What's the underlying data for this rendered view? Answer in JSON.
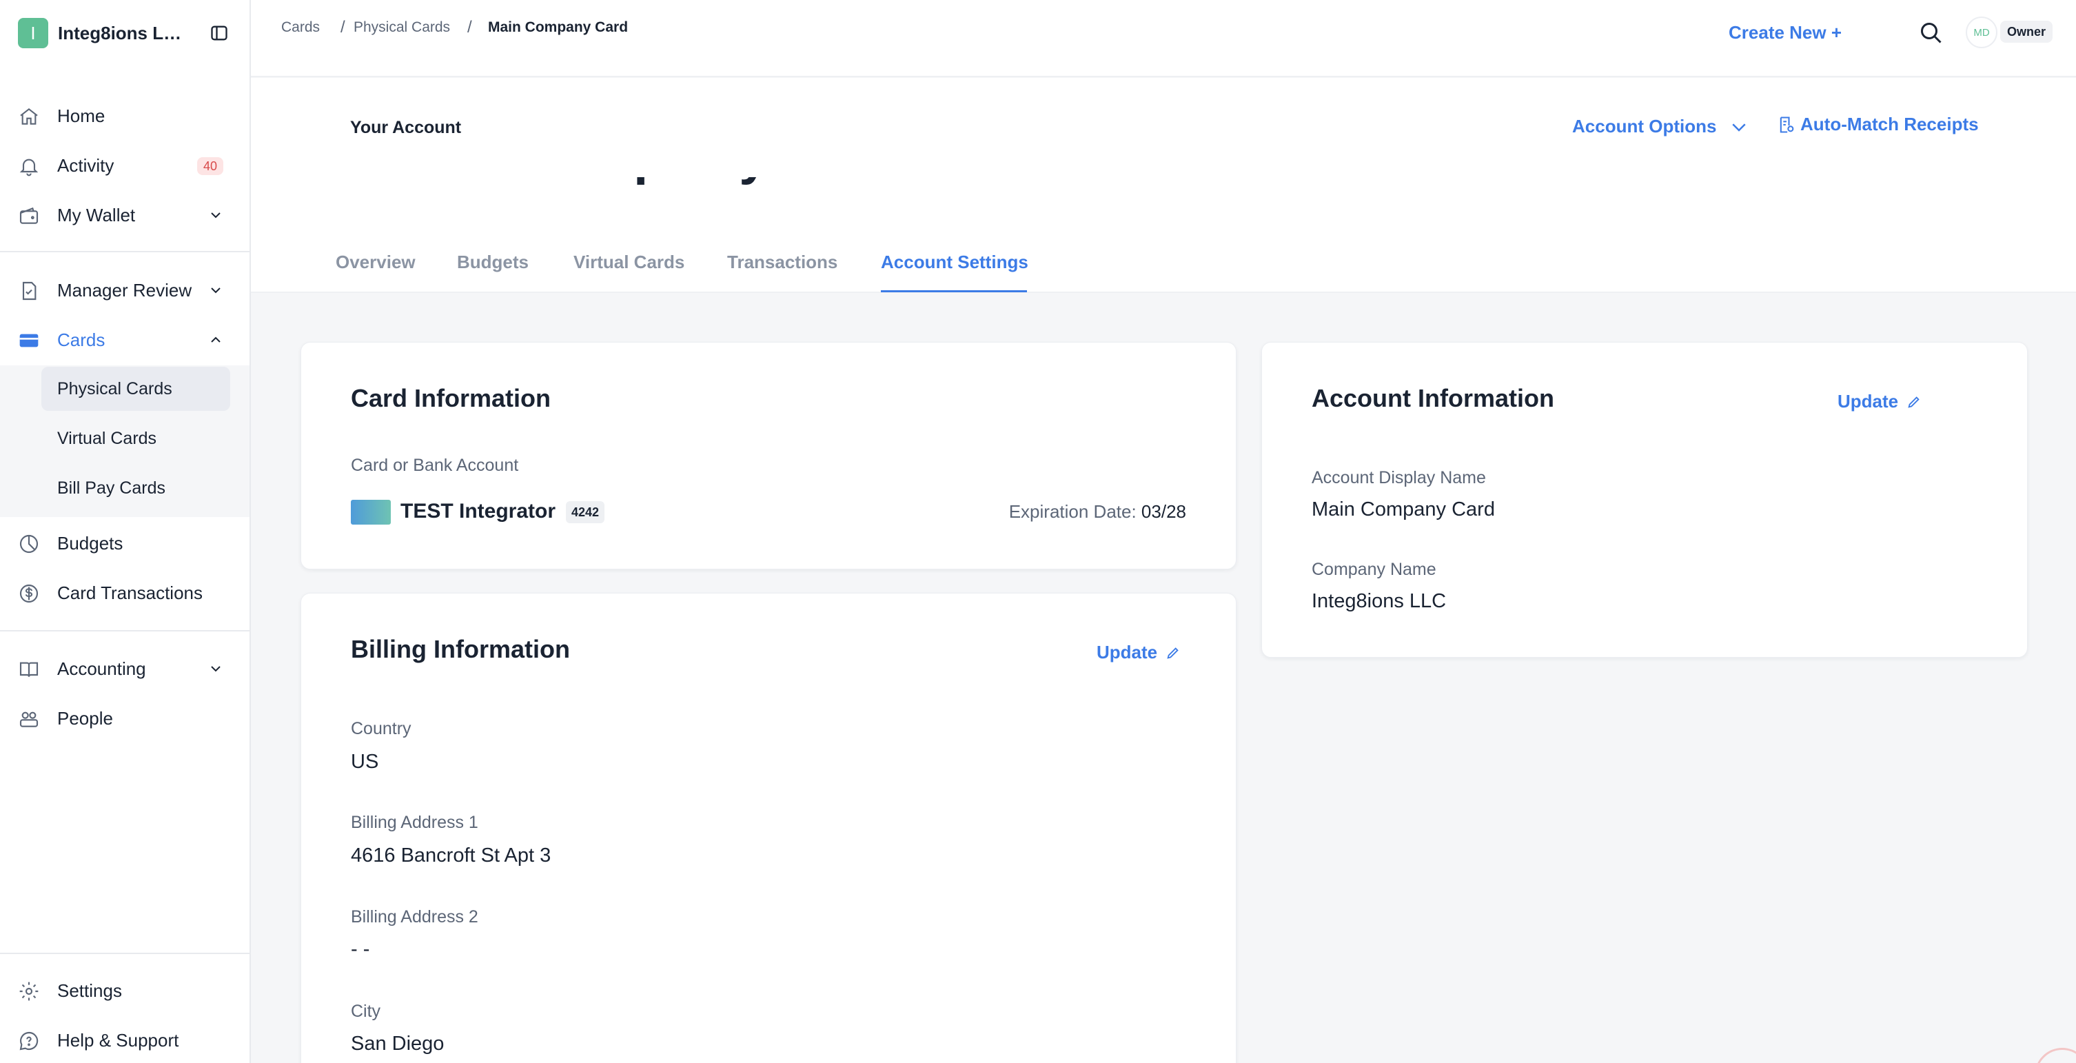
{
  "sidebar": {
    "brand_initial": "I",
    "brand_name": "Integ8ions L…",
    "items": [
      {
        "label": "Home",
        "icon": "home-icon"
      },
      {
        "label": "Activity",
        "icon": "bell-icon",
        "badge": "40"
      },
      {
        "label": "My Wallet",
        "icon": "wallet-icon"
      },
      {
        "label": "Manager Review",
        "icon": "document-check-icon"
      },
      {
        "label": "Cards",
        "icon": "credit-card-icon"
      },
      {
        "label": "Budgets",
        "icon": "pie-chart-icon"
      },
      {
        "label": "Card Transactions",
        "icon": "dollar-circle-icon"
      },
      {
        "label": "Accounting",
        "icon": "book-icon"
      },
      {
        "label": "People",
        "icon": "people-icon"
      },
      {
        "label": "Settings",
        "icon": "gear-icon"
      },
      {
        "label": "Help & Support",
        "icon": "chat-help-icon"
      }
    ],
    "card_subitems": [
      {
        "label": "Physical Cards"
      },
      {
        "label": "Virtual Cards"
      },
      {
        "label": "Bill Pay Cards"
      }
    ]
  },
  "topbar": {
    "breadcrumbs": [
      "Cards",
      "Physical Cards",
      "Main Company Card"
    ],
    "separator": "/",
    "create_new": "Create New +",
    "avatar_initials": "MD",
    "role": "Owner"
  },
  "header": {
    "eyebrow": "Your Account",
    "title": "Main Company Card",
    "account_options": "Account Options",
    "auto_match": "Auto-Match Receipts",
    "tabs": [
      "Overview",
      "Budgets",
      "Virtual Cards",
      "Transactions",
      "Account Settings"
    ],
    "active_tab": "Account Settings"
  },
  "card_info": {
    "title": "Card Information",
    "field_label": "Card or Bank Account",
    "card_name": "TEST Integrator",
    "last4": "4242",
    "expiration_label": "Expiration Date:",
    "expiration_value": "03/28"
  },
  "billing": {
    "title": "Billing Information",
    "update": "Update",
    "fields": [
      {
        "label": "Country",
        "value": "US"
      },
      {
        "label": "Billing Address 1",
        "value": "4616 Bancroft St Apt 3"
      },
      {
        "label": "Billing Address 2",
        "value": "- -"
      },
      {
        "label": "City",
        "value": "San Diego"
      }
    ]
  },
  "account_info": {
    "title": "Account Information",
    "update": "Update",
    "fields": [
      {
        "label": "Account Display Name",
        "value": "Main Company Card"
      },
      {
        "label": "Company Name",
        "value": "Integ8ions LLC"
      }
    ]
  },
  "colors": {
    "accent": "#3c7be6",
    "brand": "#5fbf95",
    "text": "#1a2332",
    "muted": "#5c6677",
    "badge_bg": "#fde4e4",
    "badge_text": "#d84a4a"
  }
}
